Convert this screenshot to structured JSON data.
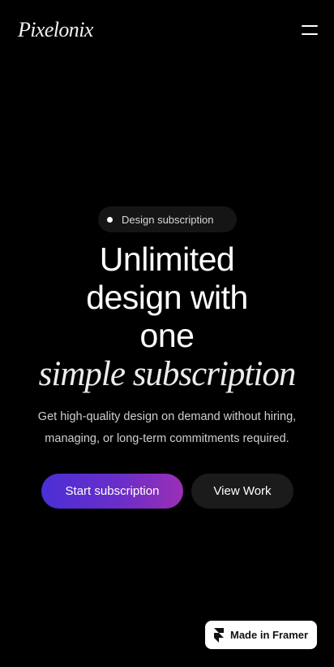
{
  "header": {
    "brand": "Pixelonix",
    "menu_icon": "hamburger-menu-icon"
  },
  "hero": {
    "badge_label": "Design subscription",
    "badge_icon": "dot-icon",
    "title_lines": [
      "Unlimited",
      "design with",
      "one"
    ],
    "title_italic": "simple subscription",
    "subtitle_lines": [
      "Get high-quality design on demand without hiring,",
      "managing, or long-term commitments required."
    ]
  },
  "actions": {
    "primary_label": "Start subscription",
    "secondary_label": "View Work"
  },
  "framer_badge": {
    "label": "Made in Framer",
    "icon": "framer-logo-icon"
  },
  "colors": {
    "background": "#000000",
    "text": "#ffffff",
    "accent_gradient_start": "#4b2fd6",
    "accent_gradient_end": "#9b2fb5",
    "secondary_button": "#1b1b1b"
  }
}
